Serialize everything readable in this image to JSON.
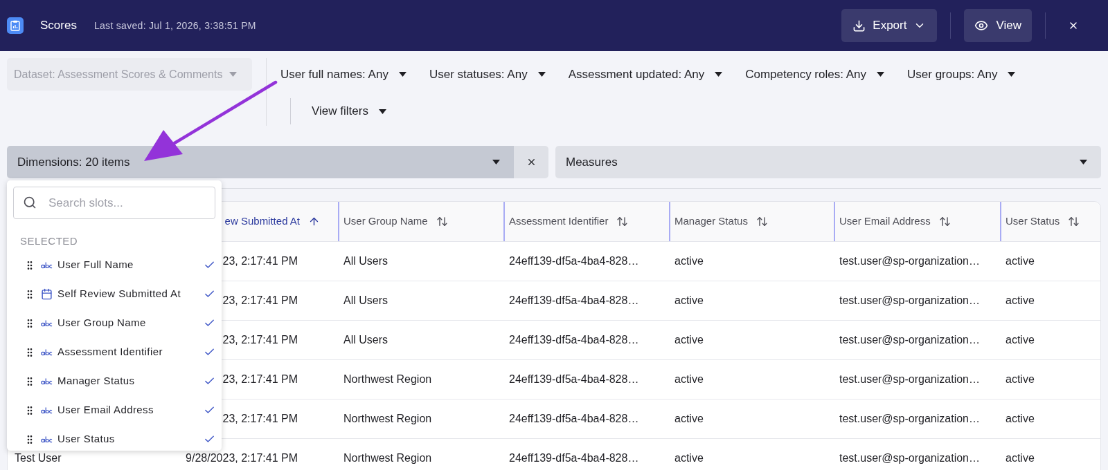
{
  "header": {
    "title": "Scores",
    "last_saved": "Last saved: Jul 1, 2026, 3:38:51 PM",
    "export_label": "Export",
    "view_label": "View"
  },
  "filters": {
    "dataset": {
      "label": "Dataset: Assessment Scores & Comments",
      "disabled": true
    },
    "items": [
      "User full names: Any",
      "User statuses: Any",
      "Assessment updated: Any",
      "Competency roles: Any",
      "User groups: Any"
    ],
    "view_filters": "View filters"
  },
  "dimensions": {
    "label": "Dimensions: 20 items"
  },
  "measures": {
    "label": "Measures"
  },
  "slot_menu": {
    "search_placeholder": "Search slots...",
    "section": "SELECTED",
    "items": [
      {
        "label": "User Full Name",
        "kind": "text",
        "checked": true
      },
      {
        "label": "Self Review Submitted At",
        "kind": "date",
        "checked": true
      },
      {
        "label": "User Group Name",
        "kind": "text",
        "checked": true
      },
      {
        "label": "Assessment Identifier",
        "kind": "text",
        "checked": true
      },
      {
        "label": "Manager Status",
        "kind": "text",
        "checked": true
      },
      {
        "label": "User Email Address",
        "kind": "text",
        "checked": true
      },
      {
        "label": "User Status",
        "kind": "text",
        "checked": true
      }
    ]
  },
  "table": {
    "columns": [
      {},
      {
        "label": "ew Submitted At",
        "sorted": true
      },
      {
        "label": "User Group Name",
        "sorted": false
      },
      {
        "label": "Assessment Identifier",
        "sorted": false
      },
      {
        "label": "Manager Status",
        "sorted": false
      },
      {
        "label": "User Email Address",
        "sorted": false
      },
      {
        "label": "User Status",
        "sorted": false
      }
    ],
    "rows": [
      {
        "cells": [
          null,
          "23, 2:17:41 PM",
          "All Users",
          "24eff139-df5a-4ba4-828…",
          "active",
          "test.user@sp-organization…",
          "active"
        ]
      },
      {
        "cells": [
          null,
          "23, 2:17:41 PM",
          "All Users",
          "24eff139-df5a-4ba4-828…",
          "active",
          "test.user@sp-organization…",
          "active"
        ]
      },
      {
        "cells": [
          null,
          "23, 2:17:41 PM",
          "All Users",
          "24eff139-df5a-4ba4-828…",
          "active",
          "test.user@sp-organization…",
          "active"
        ]
      },
      {
        "cells": [
          null,
          "23, 2:17:41 PM",
          "Northwest Region",
          "24eff139-df5a-4ba4-828…",
          "active",
          "test.user@sp-organization…",
          "active"
        ]
      },
      {
        "cells": [
          null,
          "23, 2:17:41 PM",
          "Northwest Region",
          "24eff139-df5a-4ba4-828…",
          "active",
          "test.user@sp-organization…",
          "active"
        ]
      },
      {
        "cells": [
          "Test User",
          "9/28/2023, 2:17:41 PM",
          "Northwest Region",
          "24eff139-df5a-4ba4-828…",
          "active",
          "test.user@sp-organization…",
          "active"
        ]
      }
    ]
  }
}
